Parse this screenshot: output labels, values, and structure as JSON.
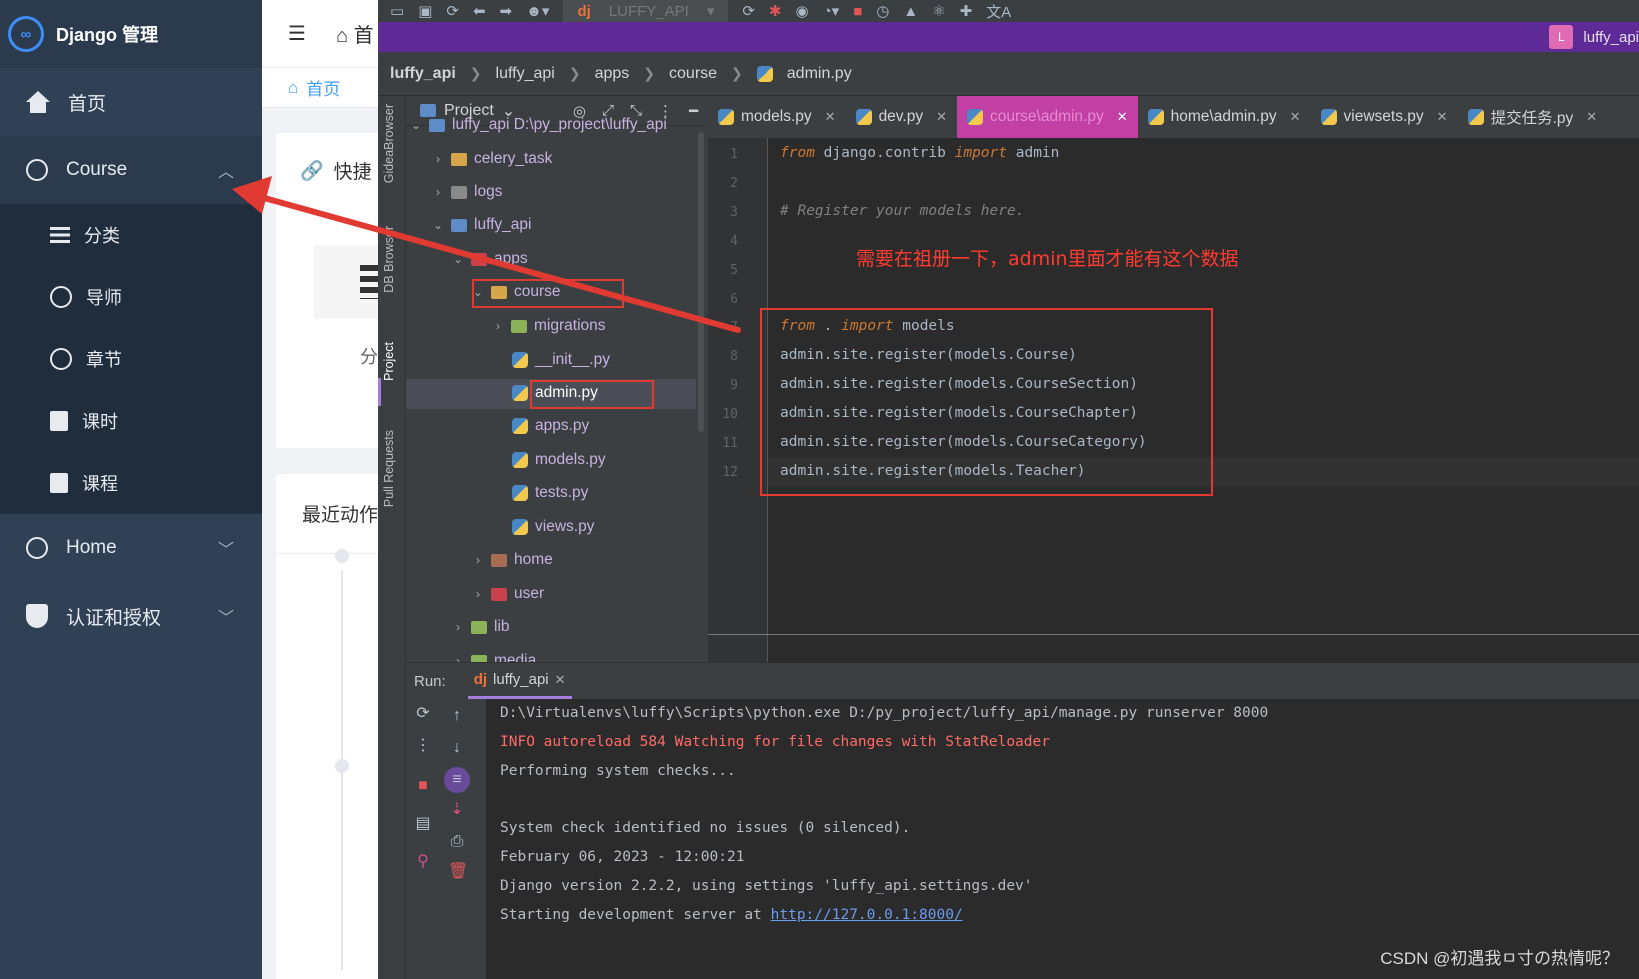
{
  "django": {
    "brand_title": "Django 管理",
    "menu": {
      "home": "首页",
      "course": "Course",
      "course_children": [
        "分类",
        "导师",
        "章节",
        "课时",
        "课程"
      ],
      "home_group": "Home",
      "auth": "认证和授权"
    },
    "topbar": {
      "hamburger": "☰",
      "home_prefix": "首"
    },
    "tabs": {
      "home": "首页"
    },
    "cards": {
      "quick_title": "快捷",
      "quick_sub": "分",
      "recent_title": "最近动作"
    }
  },
  "ide": {
    "run_config": "LUFFY_API",
    "project_name": "luffy_api",
    "breadcrumb": [
      "luffy_api",
      "luffy_api",
      "apps",
      "course",
      "admin.py"
    ],
    "side_tabs": [
      "GideaBrowser",
      "DB Browser",
      "Project",
      "Pull Requests"
    ],
    "project_view_label": "Project",
    "tree": [
      {
        "label": "luffy_api  D:\\py_project\\luffy_api"
      },
      {
        "label": "celery_task"
      },
      {
        "label": "logs"
      },
      {
        "label": "luffy_api"
      },
      {
        "label": "apps"
      },
      {
        "label": "course"
      },
      {
        "label": "migrations"
      },
      {
        "label": "__init__.py"
      },
      {
        "label": "admin.py"
      },
      {
        "label": "apps.py"
      },
      {
        "label": "models.py"
      },
      {
        "label": "tests.py"
      },
      {
        "label": "views.py"
      },
      {
        "label": "home"
      },
      {
        "label": "user"
      },
      {
        "label": "lib"
      },
      {
        "label": "media"
      }
    ],
    "tabs": [
      "models.py",
      "dev.py",
      "course\\admin.py",
      "home\\admin.py",
      "viewsets.py",
      "提交任务.py"
    ],
    "active_tab": "course\\admin.py",
    "annotation": "需要在祖册一下，admin里面才能有这个数据",
    "code": {
      "line_numbers": [
        "1",
        "2",
        "3",
        "4",
        "5",
        "6",
        "7",
        "8",
        "9",
        "10",
        "11",
        "12"
      ],
      "line1": {
        "kw1": "from",
        "mod": " django.contrib ",
        "kw2": "import",
        "name": " admin"
      },
      "line3": "# Register your models here.",
      "line7": {
        "kw1": "from",
        "mod": " . ",
        "kw2": "import",
        "name": " models"
      },
      "registers": [
        "admin.site.register(models.Course)",
        "admin.site.register(models.CourseSection)",
        "admin.site.register(models.CourseChapter)",
        "admin.site.register(models.CourseCategory)",
        "admin.site.register(models.Teacher)"
      ]
    },
    "run": {
      "label": "Run:",
      "tab": "luffy_api",
      "lines": [
        "D:\\Virtualenvs\\luffy\\Scripts\\python.exe D:/py_project/luffy_api/manage.py runserver 8000",
        "INFO autoreload 584 Watching for file changes with StatReloader",
        "Performing system checks...",
        "",
        "System check identified no issues (0 silenced).",
        "February 06, 2023 - 12:00:21",
        "Django version 2.2.2, using settings 'luffy_api.settings.dev'"
      ],
      "server_line_prefix": "Starting development server at ",
      "server_link": "http://127.0.0.1:8000/"
    }
  },
  "watermark": "CSDN @初遇我ㅁ寸の热情呢？",
  "colors": {
    "annotation_red": "#e03a33",
    "ide_accent": "#5d2a96",
    "active_tab": "#c23fa4"
  }
}
